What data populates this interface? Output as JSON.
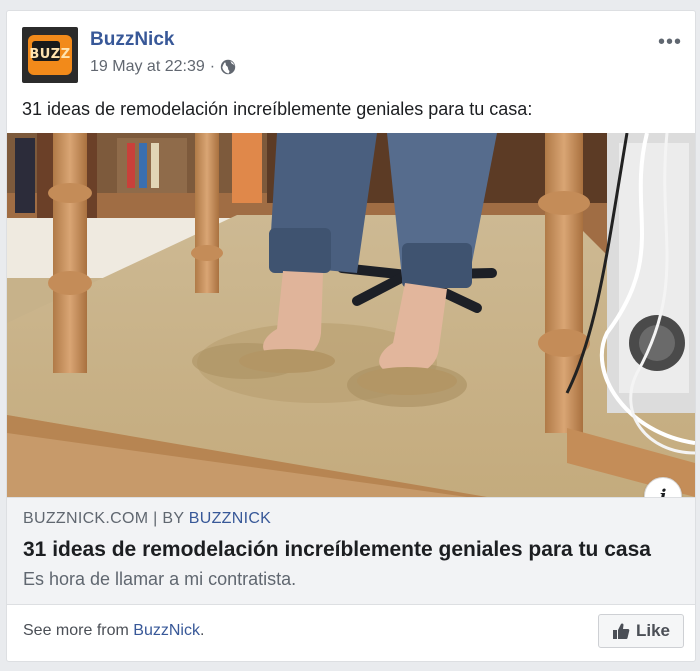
{
  "post": {
    "page_name": "BuzzNick",
    "timestamp": "19 May at 22:39",
    "separator": "·",
    "avatar_text": "BUZZ",
    "more_label": "•••",
    "text": "31 ideas de remodelación increíblemente geniales para tu casa:"
  },
  "link_preview": {
    "domain": "BUZZNICK.COM",
    "divider": "|",
    "by_prefix": "BY",
    "by_name": "BUZZNICK",
    "title": "31 ideas de remodelación increíblemente geniales para tu casa",
    "description": "Es hora de llamar a mi contratista.",
    "info_label": "i"
  },
  "footer": {
    "see_more_prefix": "See more from",
    "see_more_link": "BuzzNick",
    "see_more_suffix": ".",
    "like_label": "Like"
  },
  "colors": {
    "link_blue": "#385898",
    "meta_gray": "#616770",
    "background": "#e9ebee"
  },
  "icons": [
    "globe-icon",
    "more-options-icon",
    "info-icon",
    "thumbs-up-icon"
  ]
}
